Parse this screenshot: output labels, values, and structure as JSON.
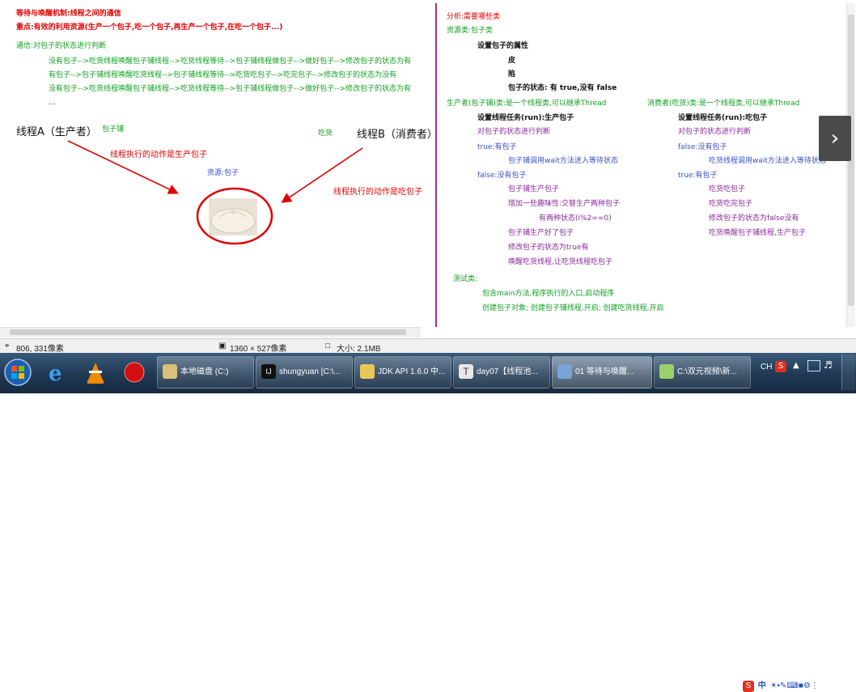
{
  "left": {
    "title": "等待与唤醒机制:线程之间的通信",
    "focus": "重点:有效的利用资源(生产一个包子,吃一个包子,再生产一个包子,在吃一个包子...)",
    "comm": "通信:对包子的状态进行判断",
    "flows": [
      "没有包子-->吃货线程唤醒包子铺线程-->吃货线程等待-->包子铺线程做包子-->做好包子-->修改包子的状态为有",
      "有包子-->包子铺线程唤醒吃货线程-->包子铺线程等待-->吃货吃包子-->吃完包子-->修改包子的状态为没有",
      "没有包子-->吃货线程唤醒包子铺线程-->吃货线程等待-->包子铺线程做包子-->做好包子-->修改包子的状态为有",
      "..."
    ],
    "thread_a": "线程A（生产者）",
    "shop": "包子铺",
    "eater": "吃货",
    "thread_b": "线程B（消费者）",
    "action_a": "线程执行的动作是生产包子",
    "resource": "资源:包子",
    "action_b": "线程执行的动作是吃包子"
  },
  "right": {
    "analysis": "分析:需要哪些类",
    "resource_class": "资源类:包子类",
    "set_attr": "设置包子的属性",
    "skin": "皮",
    "filling": "陷",
    "state": "包子的状态: 有 true,没有 false",
    "producer_class": "生产者(包子铺)类:是一个线程类,可以继承Thread",
    "p_task": "设置线程任务(run):生产包子",
    "p_judge": "对包子的状态进行判断",
    "p_true": "true:有包子",
    "p_wait": "包子铺调用wait方法进入等待状态",
    "p_false": "false:没有包子",
    "p_make": "包子铺生产包子",
    "p_fun": "增加一些趣味性:交替生产两种包子",
    "p_mod": "有两种状态(i%2==0)",
    "p_done": "包子铺生产好了包子",
    "p_set": "修改包子的状态为true有",
    "p_wake": "唤醒吃货线程,让吃货线程吃包子",
    "consumer_class": "消费者(吃货)类:是一个线程类,可以继承Thread",
    "c_task": "设置线程任务(run):吃包子",
    "c_judge": "对包子的状态进行判断",
    "c_false": "false:没有包子",
    "c_wait": "吃货线程调用wait方法进入等待状态",
    "c_true": "true:有包子",
    "c_eat": "吃货吃包子",
    "c_done": "吃货吃完包子",
    "c_set": "修改包子的状态为false没有",
    "c_wake": "吃货唤醒包子铺线程,生产包子",
    "test_class": "测试类:",
    "test_main": "包含main方法,程序执行的入口,启动程序",
    "test_create": "创建包子对象; 创建包子铺线程,开启; 创建吃货线程,开启"
  },
  "status": {
    "coords": "806, 331像素",
    "dims": "1360 × 527像素",
    "size": "大小: 2.1MB"
  },
  "taskbar": {
    "items": [
      "本地磁盘 (C:)",
      "shungyuan [C:\\...",
      "JDK API 1.6.0 中...",
      "day07【线程池...",
      "01 等待与唤醒...",
      "C:\\双元视频\\新..."
    ],
    "lang": "CH"
  },
  "ime": {
    "label": "中"
  },
  "colors": {
    "red": "#e00000",
    "green": "#12a022",
    "blue": "#3a50c8",
    "divider": "#a0308c"
  }
}
